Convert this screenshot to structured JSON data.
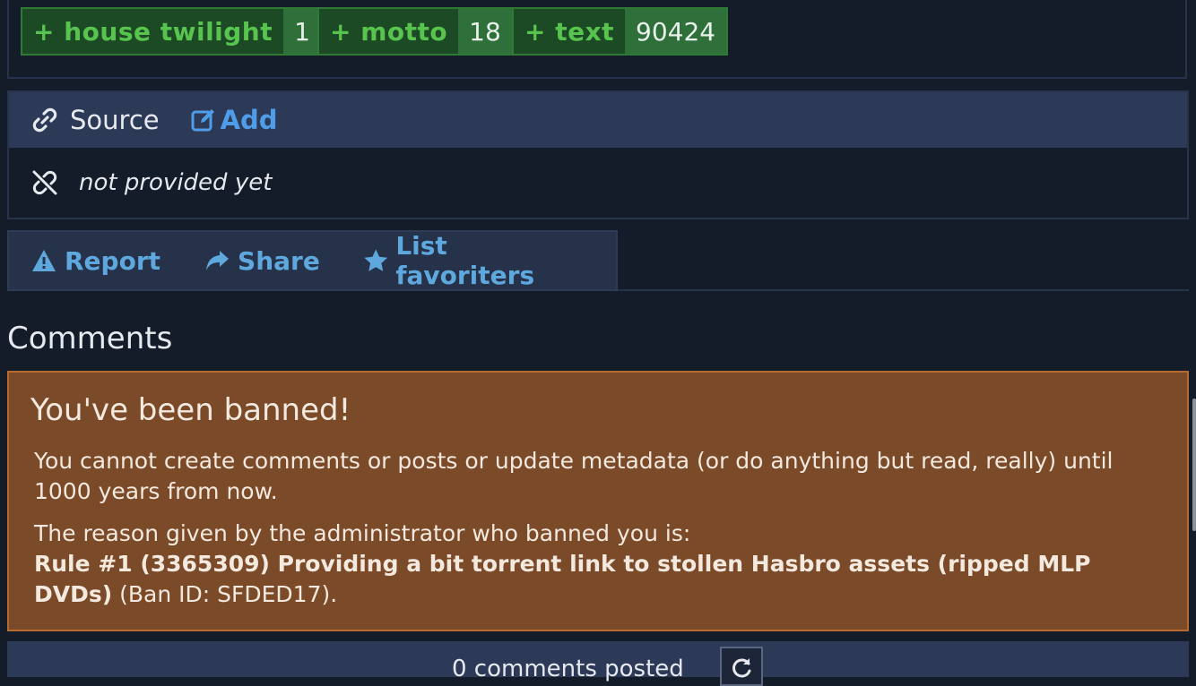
{
  "tags": [
    {
      "name": "+ house twilight",
      "count": "1"
    },
    {
      "name": "+ motto",
      "count": "18"
    },
    {
      "name": "+ text",
      "count": "90424"
    }
  ],
  "source": {
    "label": "Source",
    "add_label": "Add",
    "empty_text": "not provided yet"
  },
  "actions": {
    "report": "Report",
    "share": "Share",
    "favoriters": "List favoriters"
  },
  "comments": {
    "title": "Comments",
    "count_text": "0 comments posted"
  },
  "ban": {
    "title": "You've been banned!",
    "message": "You cannot create comments or posts or update metadata (or do anything but read, really) until 1000 years from now.",
    "reason_intro": "The reason given by the administrator who banned you is:",
    "reason": "Rule #1 (3365309) Providing a bit torrent link to stollen Hasbro assets (ripped MLP DVDs)",
    "ban_id": " (Ban ID: SFDED17)."
  },
  "colors": {
    "background": "#141c2a",
    "tag_text": "#59c34f",
    "link": "#4f9ce8",
    "ban_bg": "#7b4a28"
  }
}
